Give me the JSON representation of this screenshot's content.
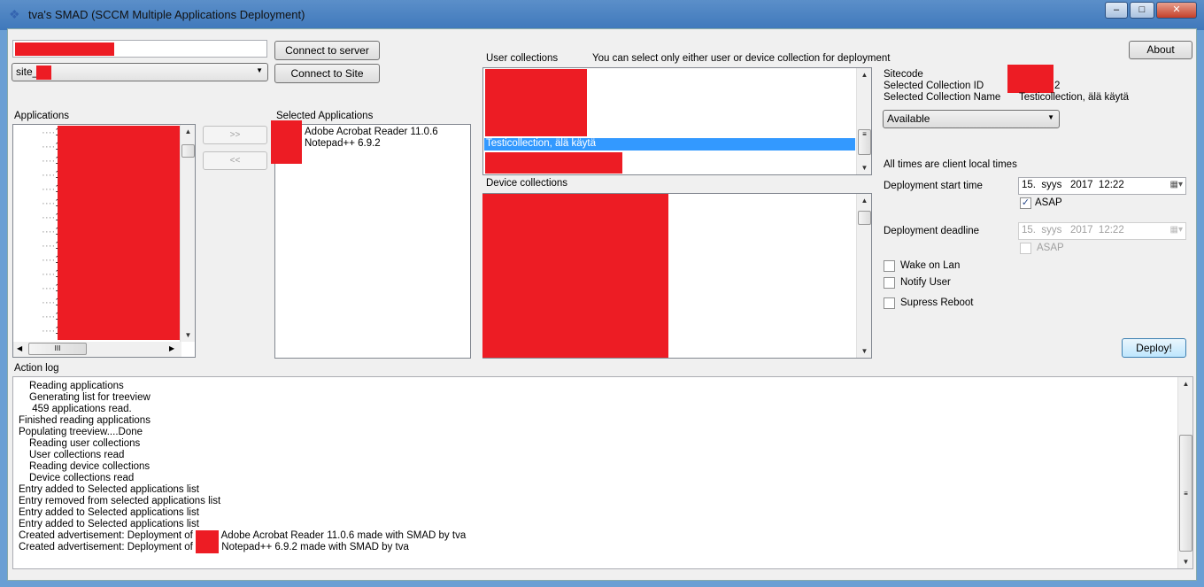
{
  "window": {
    "title": "tva's SMAD (SCCM Multiple Applications Deployment)",
    "minimize": "‒",
    "maximize": "□",
    "close": "✕"
  },
  "connection": {
    "server_value": "",
    "site_value": "site_",
    "connect_server": "Connect to server",
    "connect_site": "Connect to Site"
  },
  "applications": {
    "label": "Applications",
    "tree_prefix": "1",
    "add": ">>",
    "remove": "<<",
    "hscroll_thumb": "III"
  },
  "selected": {
    "label": "Selected Applications",
    "items": [
      "Adobe Acrobat Reader 11.0.6",
      "Notepad++ 6.9.2"
    ]
  },
  "collections": {
    "user_label": "User collections",
    "hint": "You can select only either user or device collection for deployment",
    "selected_user": "Testicollection, älä käytä",
    "device_label": "Device collections"
  },
  "info": {
    "about": "About",
    "sitecode_label": "Sitecode",
    "collection_id_label": "Selected Collection ID",
    "collection_id_suffix": "2",
    "collection_name_label": "Selected Collection Name",
    "collection_name": "Testicollection, älä käytä",
    "purpose": "Available",
    "times_note": "All times are client local times",
    "start_label": "Deployment start time",
    "start_value": "15.  syys   2017  12:22",
    "start_asap": "ASAP",
    "start_asap_checked": true,
    "deadline_label": "Deployment deadline",
    "deadline_value": "15.  syys   2017  12:22",
    "deadline_asap": "ASAP",
    "deadline_asap_checked": false,
    "wake": "Wake on Lan",
    "notify": "Notify User",
    "suppress": "Supress Reboot",
    "deploy": "Deploy!"
  },
  "log": {
    "label": "Action log",
    "lines": [
      {
        "t": "Reading applications",
        "i": 1
      },
      {
        "t": "Generating list for treeview",
        "i": 1
      },
      {
        "t": " 459 applications read.",
        "i": 1
      },
      {
        "t": "Finished reading applications",
        "i": 0
      },
      {
        "t": "Populating treeview....Done",
        "i": 0
      },
      {
        "t": "Reading user collections",
        "i": 1
      },
      {
        "t": "User collections read",
        "i": 1
      },
      {
        "t": "Reading device collections",
        "i": 1
      },
      {
        "t": "Device collections read",
        "i": 1
      },
      {
        "t": "Entry added to Selected applications list",
        "i": 0
      },
      {
        "t": "Entry removed from selected applications list",
        "i": 0
      },
      {
        "t": "Entry added to Selected applications list",
        "i": 0
      },
      {
        "t": "Entry added to Selected applications list",
        "i": 0
      },
      {
        "t": "Created advertisement: Deployment of ",
        "r": " Adobe Acrobat Reader 11.0.6 made with SMAD by tva",
        "i": 0
      },
      {
        "t": "Created advertisement: Deployment of ",
        "r": " Notepad++ 6.9.2 made with SMAD by tva",
        "i": 0
      }
    ]
  }
}
